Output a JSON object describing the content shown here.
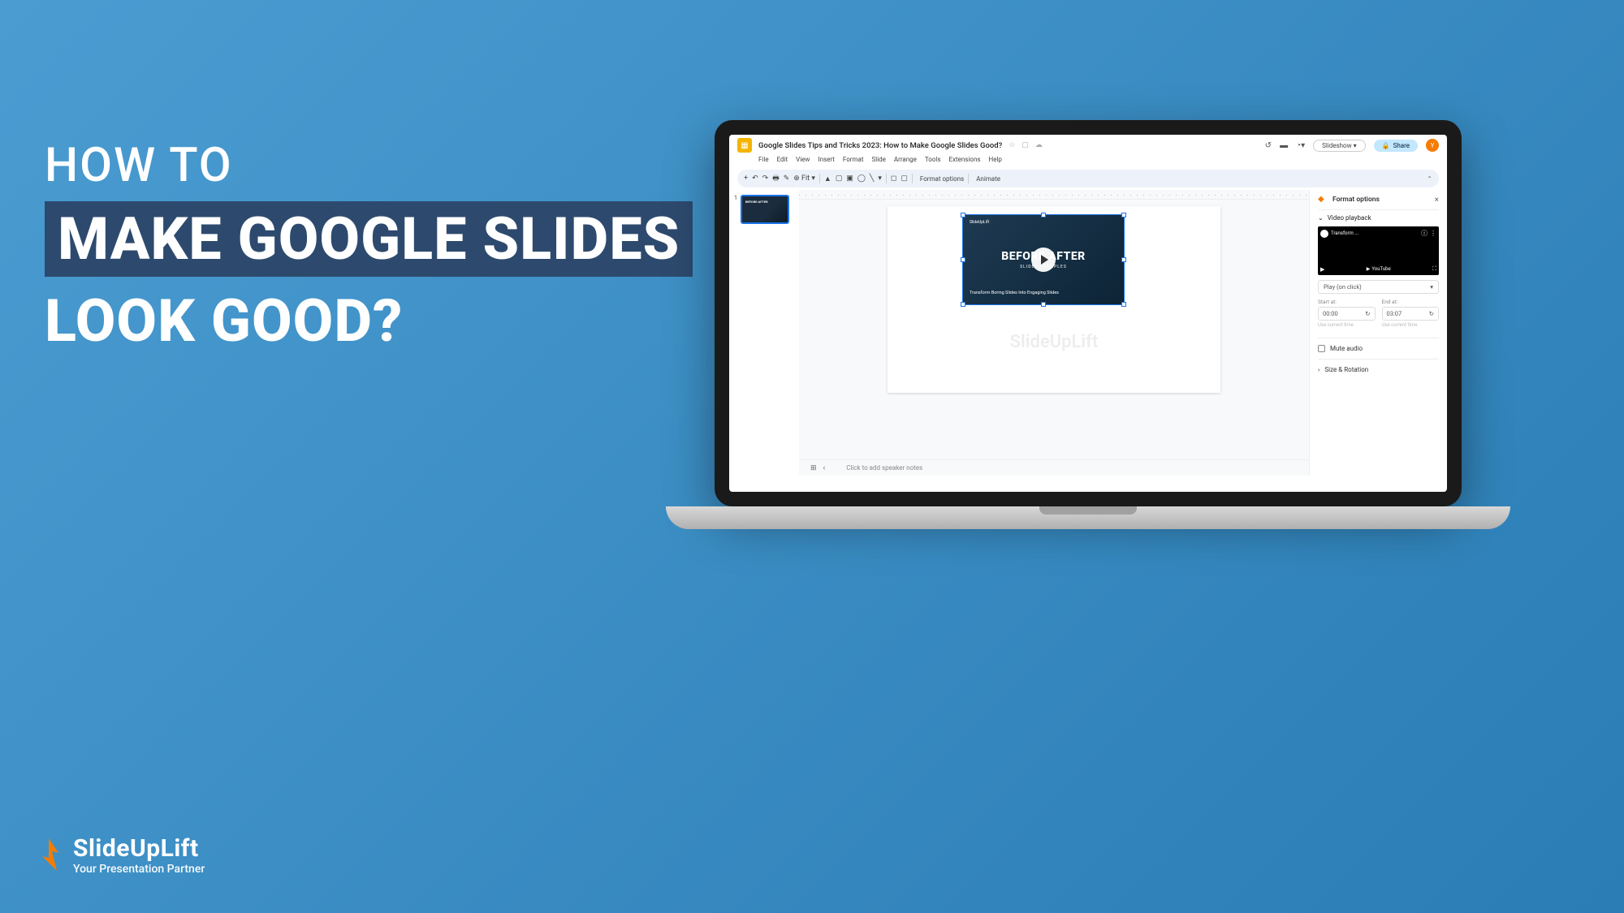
{
  "hero": {
    "line1": "HOW TO",
    "line2": "MAKE GOOGLE SLIDES",
    "line3": "LOOK GOOD?"
  },
  "brand": {
    "name": "SlideUpLift",
    "tagline": "Your Presentation Partner"
  },
  "gslides": {
    "title": "Google Slides Tips and Tricks 2023: How to Make Google Slides Good?",
    "menu": [
      "File",
      "Edit",
      "View",
      "Insert",
      "Format",
      "Slide",
      "Arrange",
      "Tools",
      "Extensions",
      "Help"
    ],
    "slideshow_label": "Slideshow",
    "share_label": "Share",
    "avatar_letter": "Y",
    "format_options": "Format options",
    "animate": "Animate",
    "slide_num": "1",
    "thumb_text": "BEFORE AFTER",
    "video": {
      "brand": "SlideUpLift",
      "title": "BEFORE   AFTER",
      "subtitle": "SLIDES EXAMPLES",
      "desc": "Transform Boring Slides\nInto Engaging Slides"
    },
    "watermark": "SlideUpLift",
    "speaker_notes": "Click to add speaker notes",
    "right_panel": {
      "title": "Format options",
      "video_playback": "Video playback",
      "yt_name": "Transform ...",
      "yt_logo": "YouTube",
      "play_mode": "Play (on click)",
      "start_label": "Start at:",
      "end_label": "End at:",
      "start_time": "00:00",
      "end_time": "03:07",
      "use_current": "Use current time",
      "mute": "Mute audio",
      "size_rotation": "Size & Rotation"
    }
  }
}
